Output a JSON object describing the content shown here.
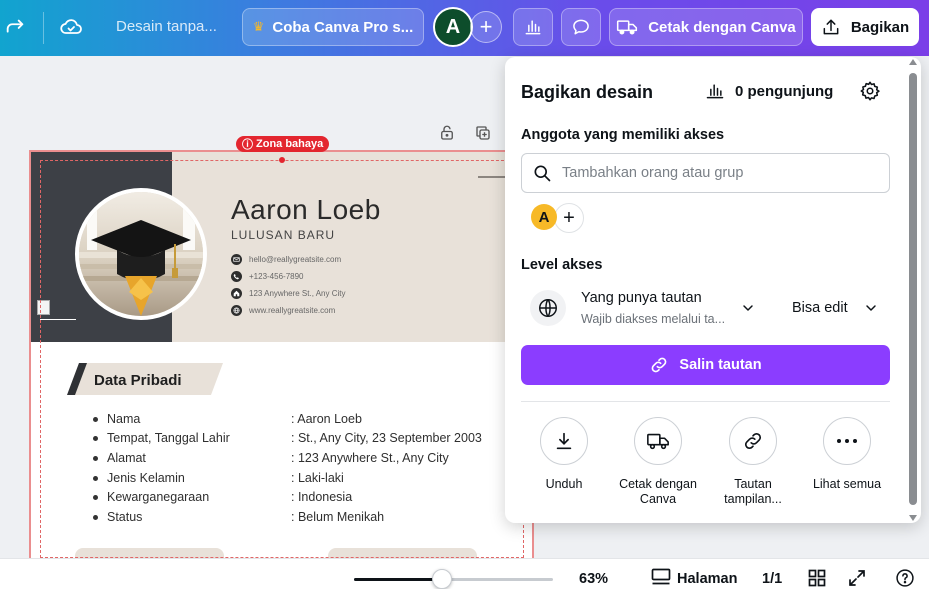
{
  "topbar": {
    "doc_title": "Desain tanpa...",
    "pro_label": "Coba Canva Pro s...",
    "avatar_initial": "A",
    "print_label": "Cetak dengan Canva",
    "share_label": "Bagikan"
  },
  "canvas": {
    "danger_zone": "Zona bahaya",
    "resume": {
      "name": "Aaron Loeb",
      "role": "LULUSAN BARU",
      "contacts": [
        {
          "icon": "email-icon",
          "text": "hello@reallygreatsite.com"
        },
        {
          "icon": "phone-icon",
          "text": "+123-456-7890"
        },
        {
          "icon": "home-icon",
          "text": "123 Anywhere St., Any City"
        },
        {
          "icon": "web-icon",
          "text": "www.reallygreatsite.com"
        }
      ],
      "section_title": "Data Pribadi",
      "fields": [
        {
          "label": "Nama",
          "value": ": Aaron Loeb"
        },
        {
          "label": "Tempat, Tanggal Lahir",
          "value": ": St., Any City, 23 September 2003"
        },
        {
          "label": "Alamat",
          "value": ": 123 Anywhere St., Any City"
        },
        {
          "label": "Jenis Kelamin",
          "value": ": Laki-laki"
        },
        {
          "label": "Kewarganegaraan",
          "value": ": Indonesia"
        },
        {
          "label": "Status",
          "value": ": Belum Menikah"
        }
      ]
    }
  },
  "share_panel": {
    "title": "Bagikan desain",
    "visitors": "0 pengunjung",
    "members_heading": "Anggota yang memiliki akses",
    "search_placeholder": "Tambahkan orang atau grup",
    "member_initial": "A",
    "access_heading": "Level akses",
    "access_who": "Yang punya tautan",
    "access_who_sub": "Wajib diakses melalui ta...",
    "access_permission": "Bisa edit",
    "copy_link": "Salin tautan",
    "actions": [
      {
        "icon": "download-icon",
        "label": "Unduh"
      },
      {
        "icon": "truck-icon",
        "label": "Cetak dengan Canva"
      },
      {
        "icon": "link-icon",
        "label": "Tautan tampilan..."
      },
      {
        "icon": "more-icon",
        "label": "Lihat semua"
      }
    ]
  },
  "bottombar": {
    "zoom_percent": "63%",
    "zoom_level": 0.44,
    "pages_label": "Halaman",
    "page_counter": "1/1"
  },
  "colors": {
    "accent_purple": "#8b3dff",
    "danger_red": "#e3262f",
    "member_avatar": "#f7b927",
    "user_avatar": "#0d4d2b"
  }
}
